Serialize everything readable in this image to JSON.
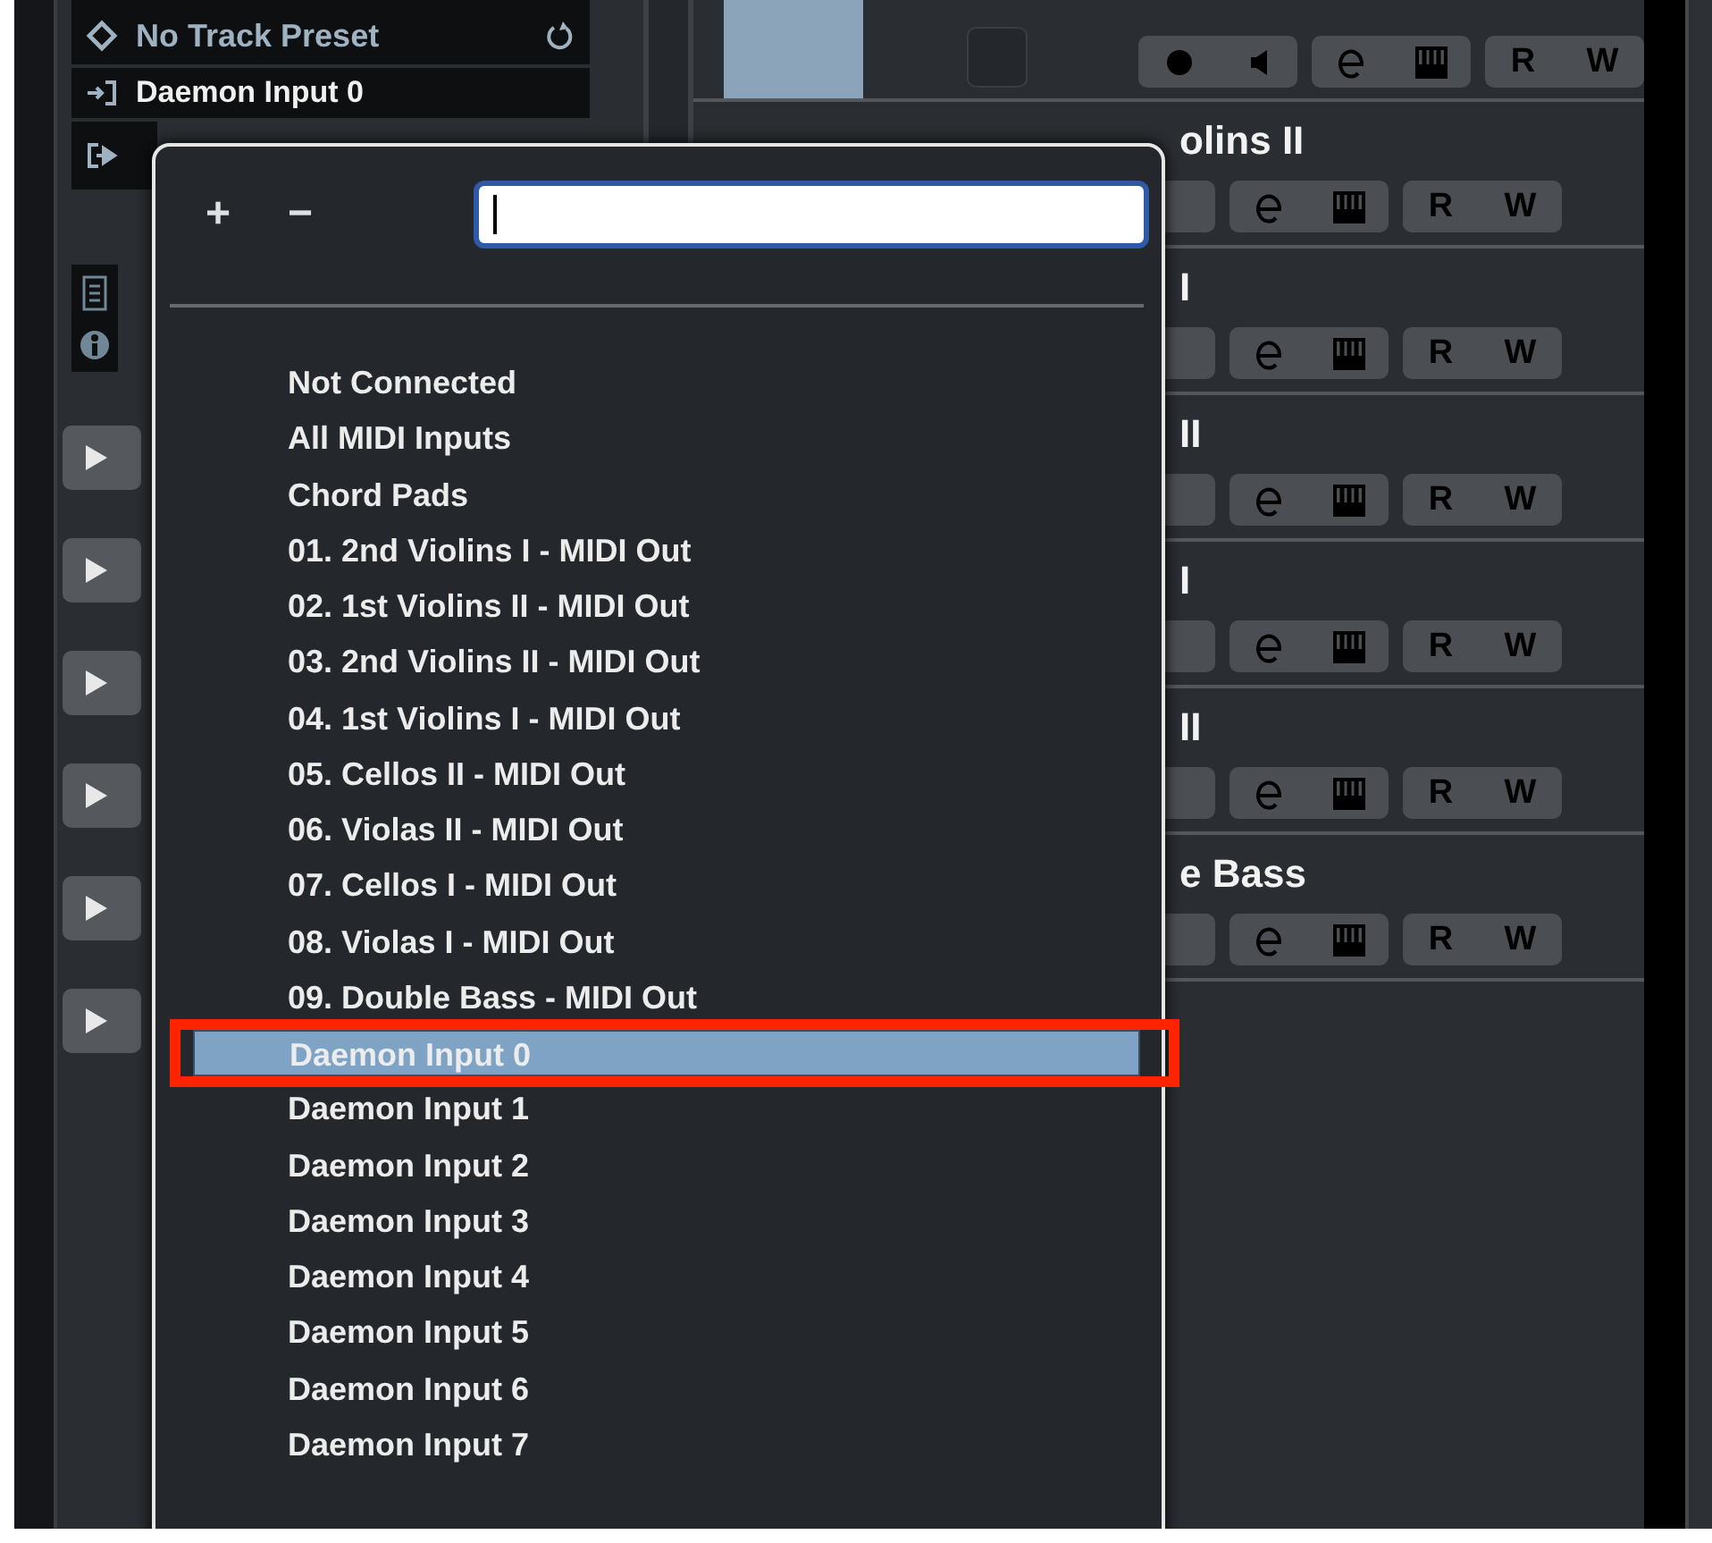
{
  "inspector": {
    "preset": "No Track Preset",
    "input": "Daemon Input 0"
  },
  "tracks": [
    {
      "kind": "top",
      "read": "R",
      "write": "W"
    },
    {
      "kind": "track",
      "name": "olins II",
      "read": "R",
      "write": "W"
    },
    {
      "kind": "track",
      "name": "I",
      "read": "R",
      "write": "W"
    },
    {
      "kind": "track",
      "name": "II",
      "read": "R",
      "write": "W"
    },
    {
      "kind": "track",
      "name": "I",
      "read": "R",
      "write": "W"
    },
    {
      "kind": "track",
      "name": "II",
      "read": "R",
      "write": "W"
    },
    {
      "kind": "track",
      "name": "e Bass",
      "read": "R",
      "write": "W"
    }
  ],
  "input_menu": {
    "add": "+",
    "remove": "−",
    "items": [
      {
        "label": "Not Connected",
        "selected": false
      },
      {
        "label": "All MIDI Inputs",
        "selected": false
      },
      {
        "label": "Chord Pads",
        "selected": false
      },
      {
        "label": "01. 2nd Violins I - MIDI Out",
        "selected": false
      },
      {
        "label": "02. 1st Violins II - MIDI Out",
        "selected": false
      },
      {
        "label": "03. 2nd Violins II - MIDI Out",
        "selected": false
      },
      {
        "label": "04. 1st Violins I - MIDI Out",
        "selected": false
      },
      {
        "label": "05. Cellos II - MIDI Out",
        "selected": false
      },
      {
        "label": "06. Violas II - MIDI Out",
        "selected": false
      },
      {
        "label": "07. Cellos I - MIDI Out",
        "selected": false
      },
      {
        "label": "08. Violas I - MIDI Out",
        "selected": false
      },
      {
        "label": "09. Double Bass - MIDI Out",
        "selected": false
      },
      {
        "label": "Daemon Input 0",
        "selected": true
      },
      {
        "label": "Daemon Input 1",
        "selected": false
      },
      {
        "label": "Daemon Input 2",
        "selected": false
      },
      {
        "label": "Daemon Input 3",
        "selected": false
      },
      {
        "label": "Daemon Input 4",
        "selected": false
      },
      {
        "label": "Daemon Input 5",
        "selected": false
      },
      {
        "label": "Daemon Input 6",
        "selected": false
      },
      {
        "label": "Daemon Input 7",
        "selected": false
      }
    ]
  }
}
